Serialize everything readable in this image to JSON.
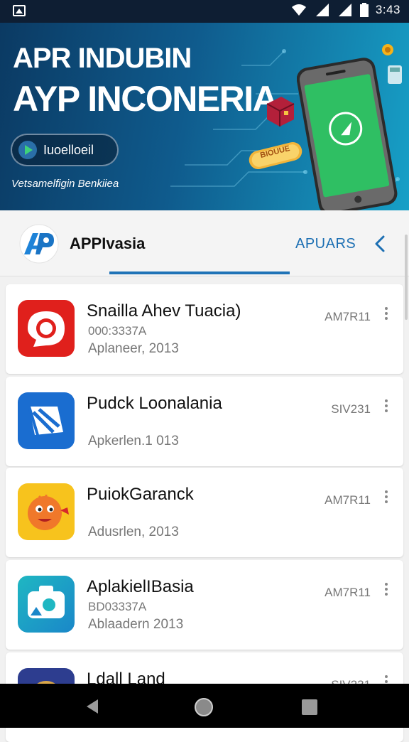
{
  "status_bar": {
    "time": "3:43"
  },
  "banner": {
    "title_line1": "APR INDUBIN",
    "title_line2": "AYP INCONERIA",
    "pill_label": "Iuoelloeil",
    "caption": "Vetsamelfigin Benkiiea",
    "ticket_text": "BIOUUE",
    "colors": {
      "bg_start": "#0b3a63",
      "bg_end": "#17a0c7",
      "phone_screen": "#2fbf63"
    }
  },
  "app_bar": {
    "brand": "APPIvasia",
    "tab_right": "APUARS",
    "logo_letters": "AP",
    "accent": "#1f73b7"
  },
  "apps": [
    {
      "name": "Snailla Ahev Tuacia)",
      "sub": "000:3337A",
      "date": "Aplaneer, 2013",
      "meta": "AM7R11",
      "icon": "chat-bubble-icon",
      "icon_color": "#e0201c"
    },
    {
      "name": "Pudck Loonalania",
      "sub": "",
      "date": "Apkerlen.1 013",
      "meta": "SIV231",
      "icon": "note-edit-icon",
      "icon_color": "#1a6dd0"
    },
    {
      "name": "PuiokGaranck",
      "sub": "",
      "date": "Adusrlen, 2013",
      "meta": "AM7R11",
      "icon": "orange-face-icon",
      "icon_color": "#f7c31d"
    },
    {
      "name": "AplakielIBasia",
      "sub": "BD03337A",
      "date": "Ablaadern 2013",
      "meta": "AM7R11",
      "icon": "camera-badge-icon",
      "icon_color": "#1fb7c2"
    },
    {
      "name": "Ldall Land",
      "sub": "",
      "date": "",
      "meta": "SIV231",
      "icon": "partial-app-icon",
      "icon_color": "#2d3d8f"
    }
  ],
  "navbar": {
    "back": "back-icon",
    "home": "home-icon",
    "recents": "recents-icon"
  }
}
